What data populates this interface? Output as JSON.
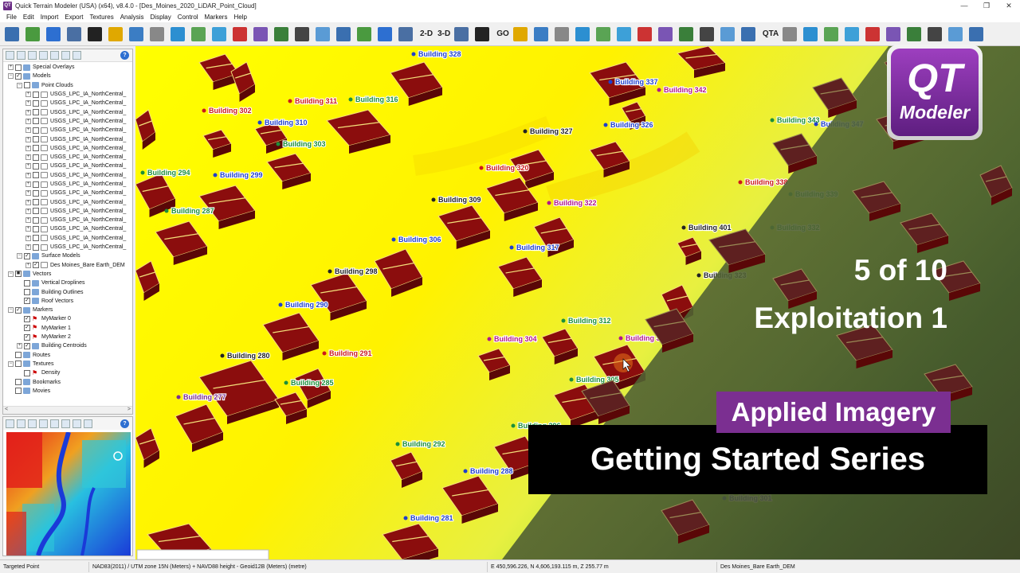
{
  "window": {
    "title": "Quick Terrain Modeler (USA) (x64), v8.4.0 - [Des_Moines_2020_LiDAR_Point_Cloud]",
    "app_icon": "QT",
    "controls": [
      "—",
      "❐",
      "✕"
    ]
  },
  "menu": [
    "File",
    "Edit",
    "Import",
    "Export",
    "Textures",
    "Analysis",
    "Display",
    "Control",
    "Markers",
    "Help"
  ],
  "toolbar": {
    "labels": {
      "view_2d": "2-D",
      "view_3d": "3-D",
      "go": "GO",
      "qta": "QTA"
    },
    "icon_colors": [
      "#3a6fb0",
      "#4a9a3f",
      "#2d6fd1",
      "#4a6fa3",
      "#222222",
      "#e0a800",
      "#3b7dc4",
      "#888888",
      "#2c8fd1",
      "#5aa454",
      "#3da0d8",
      "#cc3333",
      "#7a55b4",
      "#3a7f3a",
      "#444444",
      "#5a9bd5"
    ]
  },
  "tree": {
    "items": [
      {
        "level": 0,
        "exp": "+",
        "check": "",
        "icon": "folder",
        "label": "Special Overlays"
      },
      {
        "level": 0,
        "exp": "−",
        "check": "✓",
        "icon": "folder",
        "label": "Models"
      },
      {
        "level": 1,
        "exp": "−",
        "check": "",
        "icon": "folder",
        "label": "Point Clouds"
      },
      {
        "level": 2,
        "exp": "+",
        "check": "",
        "icon": "cloud",
        "label": "USGS_LPC_IA_NorthCentral_"
      },
      {
        "level": 2,
        "exp": "+",
        "check": "",
        "icon": "cloud",
        "label": "USGS_LPC_IA_NorthCentral_"
      },
      {
        "level": 2,
        "exp": "+",
        "check": "",
        "icon": "cloud",
        "label": "USGS_LPC_IA_NorthCentral_"
      },
      {
        "level": 2,
        "exp": "+",
        "check": "",
        "icon": "cloud",
        "label": "USGS_LPC_IA_NorthCentral_"
      },
      {
        "level": 2,
        "exp": "+",
        "check": "",
        "icon": "cloud",
        "label": "USGS_LPC_IA_NorthCentral_"
      },
      {
        "level": 2,
        "exp": "+",
        "check": "",
        "icon": "cloud",
        "label": "USGS_LPC_IA_NorthCentral_"
      },
      {
        "level": 2,
        "exp": "+",
        "check": "",
        "icon": "cloud",
        "label": "USGS_LPC_IA_NorthCentral_"
      },
      {
        "level": 2,
        "exp": "+",
        "check": "",
        "icon": "cloud",
        "label": "USGS_LPC_IA_NorthCentral_"
      },
      {
        "level": 2,
        "exp": "+",
        "check": "",
        "icon": "cloud",
        "label": "USGS_LPC_IA_NorthCentral_"
      },
      {
        "level": 2,
        "exp": "+",
        "check": "",
        "icon": "cloud",
        "label": "USGS_LPC_IA_NorthCentral_"
      },
      {
        "level": 2,
        "exp": "+",
        "check": "",
        "icon": "cloud",
        "label": "USGS_LPC_IA_NorthCentral_"
      },
      {
        "level": 2,
        "exp": "+",
        "check": "",
        "icon": "cloud",
        "label": "USGS_LPC_IA_NorthCentral_"
      },
      {
        "level": 2,
        "exp": "+",
        "check": "",
        "icon": "cloud",
        "label": "USGS_LPC_IA_NorthCentral_"
      },
      {
        "level": 2,
        "exp": "+",
        "check": "",
        "icon": "cloud",
        "label": "USGS_LPC_IA_NorthCentral_"
      },
      {
        "level": 2,
        "exp": "+",
        "check": "",
        "icon": "cloud",
        "label": "USGS_LPC_IA_NorthCentral_"
      },
      {
        "level": 2,
        "exp": "+",
        "check": "",
        "icon": "cloud",
        "label": "USGS_LPC_IA_NorthCentral_"
      },
      {
        "level": 2,
        "exp": "+",
        "check": "",
        "icon": "cloud",
        "label": "USGS_LPC_IA_NorthCentral_"
      },
      {
        "level": 2,
        "exp": "+",
        "check": "",
        "icon": "cloud",
        "label": "USGS_LPC_IA_NorthCentral_"
      },
      {
        "level": 1,
        "exp": "−",
        "check": "✓",
        "icon": "folder",
        "label": "Surface Models"
      },
      {
        "level": 2,
        "exp": "+",
        "check": "✓",
        "icon": "cloud",
        "label": "Des Moines_Bare Earth_DEM"
      },
      {
        "level": 0,
        "exp": "−",
        "check": "■",
        "icon": "folder",
        "label": "Vectors"
      },
      {
        "level": 1,
        "exp": "",
        "check": "",
        "icon": "folder",
        "label": "Vertical Droplines"
      },
      {
        "level": 1,
        "exp": "",
        "check": "",
        "icon": "folder",
        "label": "Building Outlines"
      },
      {
        "level": 1,
        "exp": "",
        "check": "✓",
        "icon": "folder",
        "label": "Roof Vectors"
      },
      {
        "level": 0,
        "exp": "−",
        "check": "✓",
        "icon": "folder",
        "label": "Markers"
      },
      {
        "level": 1,
        "exp": "",
        "check": "✓",
        "icon": "pin",
        "label": "MyMarker 0"
      },
      {
        "level": 1,
        "exp": "",
        "check": "✓",
        "icon": "pin",
        "label": "MyMarker 1"
      },
      {
        "level": 1,
        "exp": "",
        "check": "✓",
        "icon": "pin",
        "label": "MyMarker 2"
      },
      {
        "level": 1,
        "exp": "+",
        "check": "✓",
        "icon": "folder",
        "label": "Building Centroids"
      },
      {
        "level": 0,
        "exp": "",
        "check": "",
        "icon": "folder",
        "label": "Routes"
      },
      {
        "level": 0,
        "exp": "−",
        "check": "",
        "icon": "folder",
        "label": "Textures"
      },
      {
        "level": 1,
        "exp": "",
        "check": "",
        "icon": "pin",
        "label": "Density"
      },
      {
        "level": 0,
        "exp": "",
        "check": "",
        "icon": "folder",
        "label": "Bookmarks"
      },
      {
        "level": 0,
        "exp": "",
        "check": "",
        "icon": "folder",
        "label": "Movies"
      }
    ],
    "scroll_left": "<",
    "scroll_right": ">"
  },
  "buildings": [
    {
      "label": "Building 328",
      "color": "#1f3fcc"
    },
    {
      "label": "Building 337",
      "color": "#1f3fcc"
    },
    {
      "label": "Building 342",
      "color": "#b2188a"
    },
    {
      "label": "Building 302",
      "color": "#cc1a1a"
    },
    {
      "label": "Building 311",
      "color": "#cc1a1a"
    },
    {
      "label": "Building 316",
      "color": "#1c8f3a"
    },
    {
      "label": "Building 310",
      "color": "#1f3fcc"
    },
    {
      "label": "Building 303",
      "color": "#1c8f3a"
    },
    {
      "label": "Building 327",
      "color": "#222222"
    },
    {
      "label": "Building 326",
      "color": "#1f3fcc"
    },
    {
      "label": "Building 294",
      "color": "#1c8f3a"
    },
    {
      "label": "Building 299",
      "color": "#1f3fcc"
    },
    {
      "label": "Building 320",
      "color": "#cc1a1a"
    },
    {
      "label": "Building 309",
      "color": "#222222"
    },
    {
      "label": "Building 322",
      "color": "#b2188a"
    },
    {
      "label": "Building 287",
      "color": "#1c8f3a"
    },
    {
      "label": "Building 306",
      "color": "#1f3fcc"
    },
    {
      "label": "Building 317",
      "color": "#1f3fcc"
    },
    {
      "label": "Building 401",
      "color": "#222222"
    },
    {
      "label": "Building 298",
      "color": "#222222"
    },
    {
      "label": "Building 290",
      "color": "#1f3fcc"
    },
    {
      "label": "Building 312",
      "color": "#1c8f3a"
    },
    {
      "label": "Building 304",
      "color": "#b2188a"
    },
    {
      "label": "Building 318",
      "color": "#b2188a"
    },
    {
      "label": "Building 280",
      "color": "#222222"
    },
    {
      "label": "Building 291",
      "color": "#cc1a1a"
    },
    {
      "label": "Building 285",
      "color": "#1c8f3a"
    },
    {
      "label": "Building 305",
      "color": "#1c8f3a"
    },
    {
      "label": "Building 277",
      "color": "#7b2f91"
    },
    {
      "label": "Building 296",
      "color": "#1c8f3a"
    },
    {
      "label": "Building 292",
      "color": "#1c8f3a"
    },
    {
      "label": "Building 288",
      "color": "#1f3fcc"
    },
    {
      "label": "Building 281",
      "color": "#1f3fcc"
    },
    {
      "label": "Building 343",
      "color": "#1c8f3a"
    },
    {
      "label": "Building 347",
      "color": "#1f3fcc"
    },
    {
      "label": "Building 338",
      "color": "#cc1a1a"
    },
    {
      "label": "Building 339",
      "color": "#1c8f3a"
    },
    {
      "label": "Building 332",
      "color": "#1c8f3a"
    },
    {
      "label": "Building 323",
      "color": "#222222"
    },
    {
      "label": "Building 301",
      "color": "#1f3fcc"
    }
  ],
  "overlay": {
    "logo_main": "QT",
    "logo_sub": "Modeler",
    "episode": "5 of 10",
    "topic": "Exploitation 1",
    "brand": "Applied Imagery",
    "series": "Getting Started Series"
  },
  "status": {
    "mode": "Targeted Point",
    "datum": "NAD83(2011) / UTM zone 15N (Meters) + NAVD88 height - Geoid12B (Meters) (metre)",
    "coords": "E 450,596.226, N 4,606,193.115 m, Z 255.77 m",
    "model": "Des Moines_Bare Earth_DEM"
  },
  "colors": {
    "accent": "#7b2f91",
    "roof": "#8b0d0d",
    "terrain_high": "#ffff00",
    "terrain_low": "#33cc33"
  }
}
